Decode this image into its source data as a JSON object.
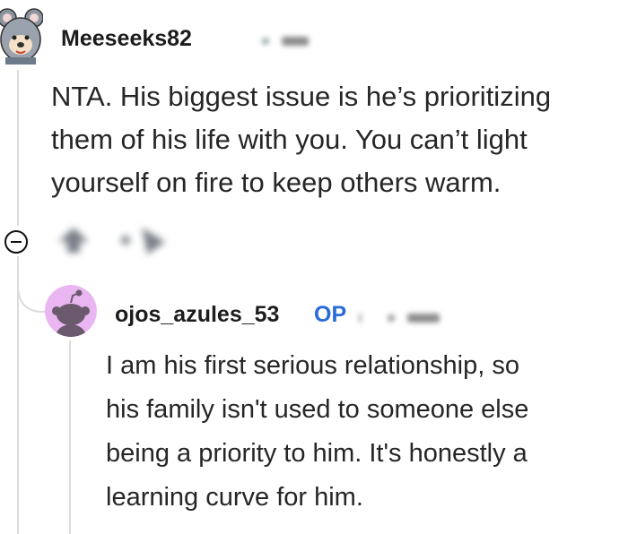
{
  "comment": {
    "username": "Meeseeks82",
    "avatar_icon": "koala-avatar-icon",
    "body": "NTA. His biggest issue is he’s prioritizing\nthem of his life with you. You can’t light\nyourself on fire to keep others warm."
  },
  "reply": {
    "username": "ojos_azules_53",
    "op_badge": "OP",
    "avatar_icon": "snoo-avatar-icon",
    "avatar_bg": "#e9b6f2",
    "body": "I am his first serious relationship, so\nhis family isn't used to someone else\nbeing a priority to him. It's honestly a\nlearning curve for him."
  },
  "actions": {
    "collapse_icon": "collapse-icon",
    "upvote_icon": "upvote-icon",
    "reply_icon": "reply-icon"
  },
  "colors": {
    "op": "#2a6ad9",
    "thread_line": "#dcdcdc"
  }
}
